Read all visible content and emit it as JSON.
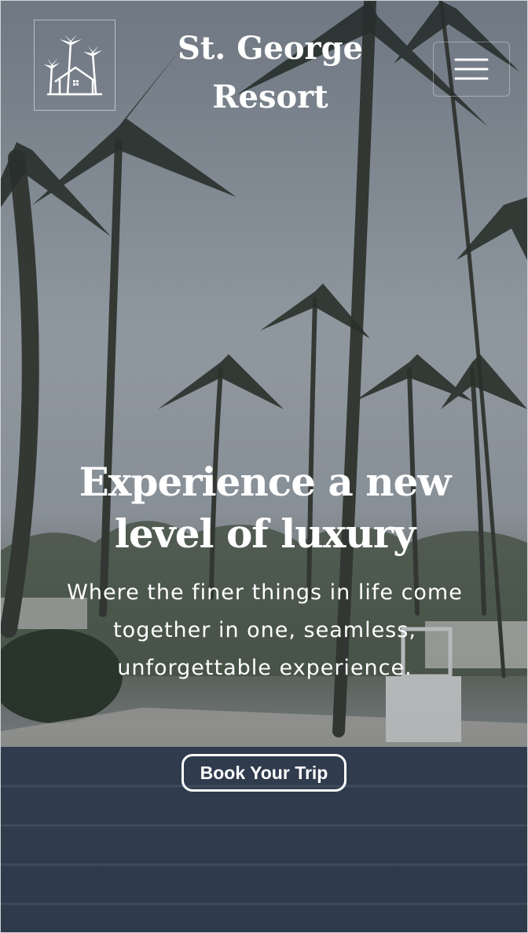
{
  "header": {
    "brand_name": "St. George Resort",
    "logo_icon": "palm-tree-house-icon",
    "menu_icon": "hamburger-menu-icon"
  },
  "hero": {
    "headline": "Experience a new level of luxury",
    "subheading": "Where the finer things in life come together in one, seamless, unforgettable experience.",
    "cta_label": "Book Your Trip",
    "background": "palm-trees-resort-pool-photo"
  },
  "colors": {
    "text": "#ffffff",
    "overlay": "#1e2837"
  }
}
